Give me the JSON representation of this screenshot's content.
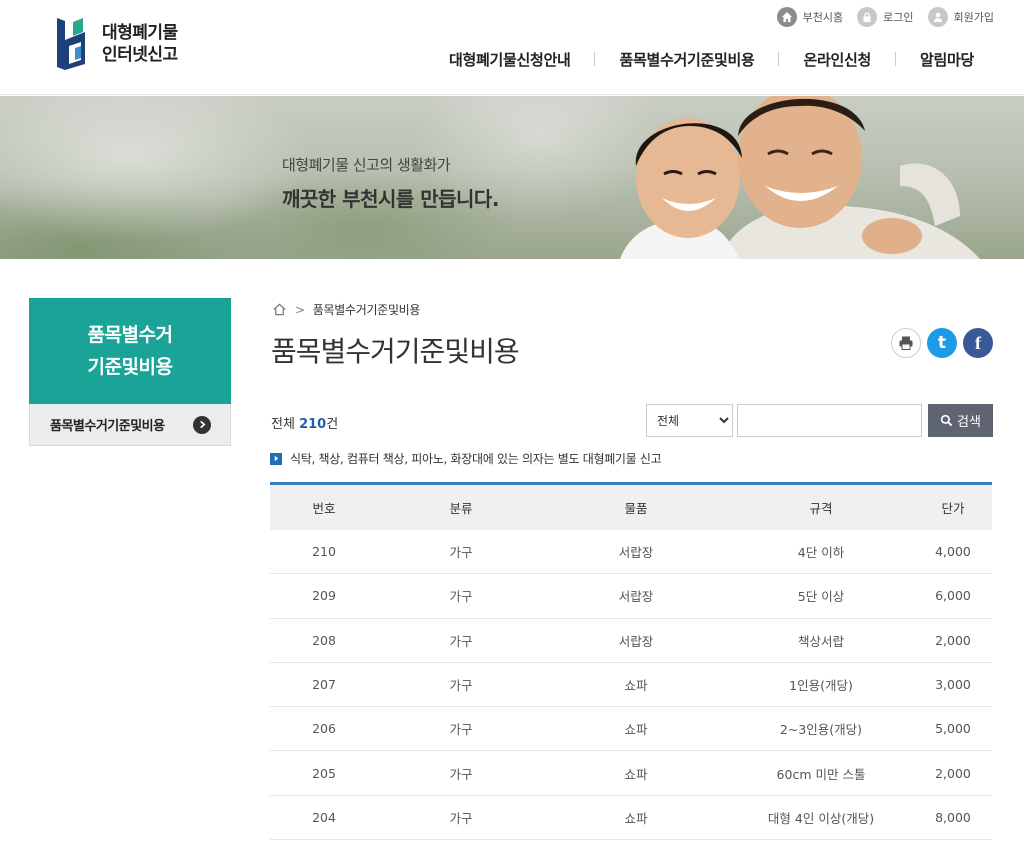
{
  "header": {
    "logo": {
      "line1": "대형폐기물",
      "line2": "인터넷신고"
    },
    "util": [
      {
        "label": "부천시홈",
        "icon": "home-icon"
      },
      {
        "label": "로그인",
        "icon": "lock-icon"
      },
      {
        "label": "회원가입",
        "icon": "user-icon"
      }
    ],
    "nav": [
      "대형폐기물신청안내",
      "품목별수거기준및비용",
      "온라인신청",
      "알림마당"
    ]
  },
  "banner": {
    "line1": "대형폐기물 신고의 생활화가",
    "line2": "깨끗한 부천시를 만듭니다."
  },
  "sidebar": {
    "title_line1": "품목별수거",
    "title_line2": "기준및비용",
    "item": "품목별수거기준및비용"
  },
  "content": {
    "breadcrumb": "품목별수거기준및비용",
    "title": "품목별수거기준및비용",
    "total_label": "전체",
    "total_count": "210",
    "total_unit": "건",
    "search": {
      "select_value": "전체",
      "input_value": "",
      "button": "검색"
    },
    "notice": "식탁, 책상, 컴퓨터 책상, 피아노, 화장대에 있는 의자는 별도 대형폐기물 신고"
  },
  "table": {
    "headers": [
      "번호",
      "분류",
      "물품",
      "규격",
      "단가"
    ],
    "rows": [
      [
        "210",
        "가구",
        "서랍장",
        "4단 이하",
        "4,000"
      ],
      [
        "209",
        "가구",
        "서랍장",
        "5단 이상",
        "6,000"
      ],
      [
        "208",
        "가구",
        "서랍장",
        "책상서랍",
        "2,000"
      ],
      [
        "207",
        "가구",
        "쇼파",
        "1인용(개당)",
        "3,000"
      ],
      [
        "206",
        "가구",
        "쇼파",
        "2~3인용(개당)",
        "5,000"
      ],
      [
        "205",
        "가구",
        "쇼파",
        "60cm 미만 스툴",
        "2,000"
      ],
      [
        "204",
        "가구",
        "쇼파",
        "대형 4인 이상(개당)",
        "8,000"
      ]
    ]
  },
  "colors": {
    "accent_teal": "#1aa397",
    "table_border_blue": "#3a7fc4",
    "count_blue": "#1f5fae",
    "search_button": "#5e6471"
  }
}
